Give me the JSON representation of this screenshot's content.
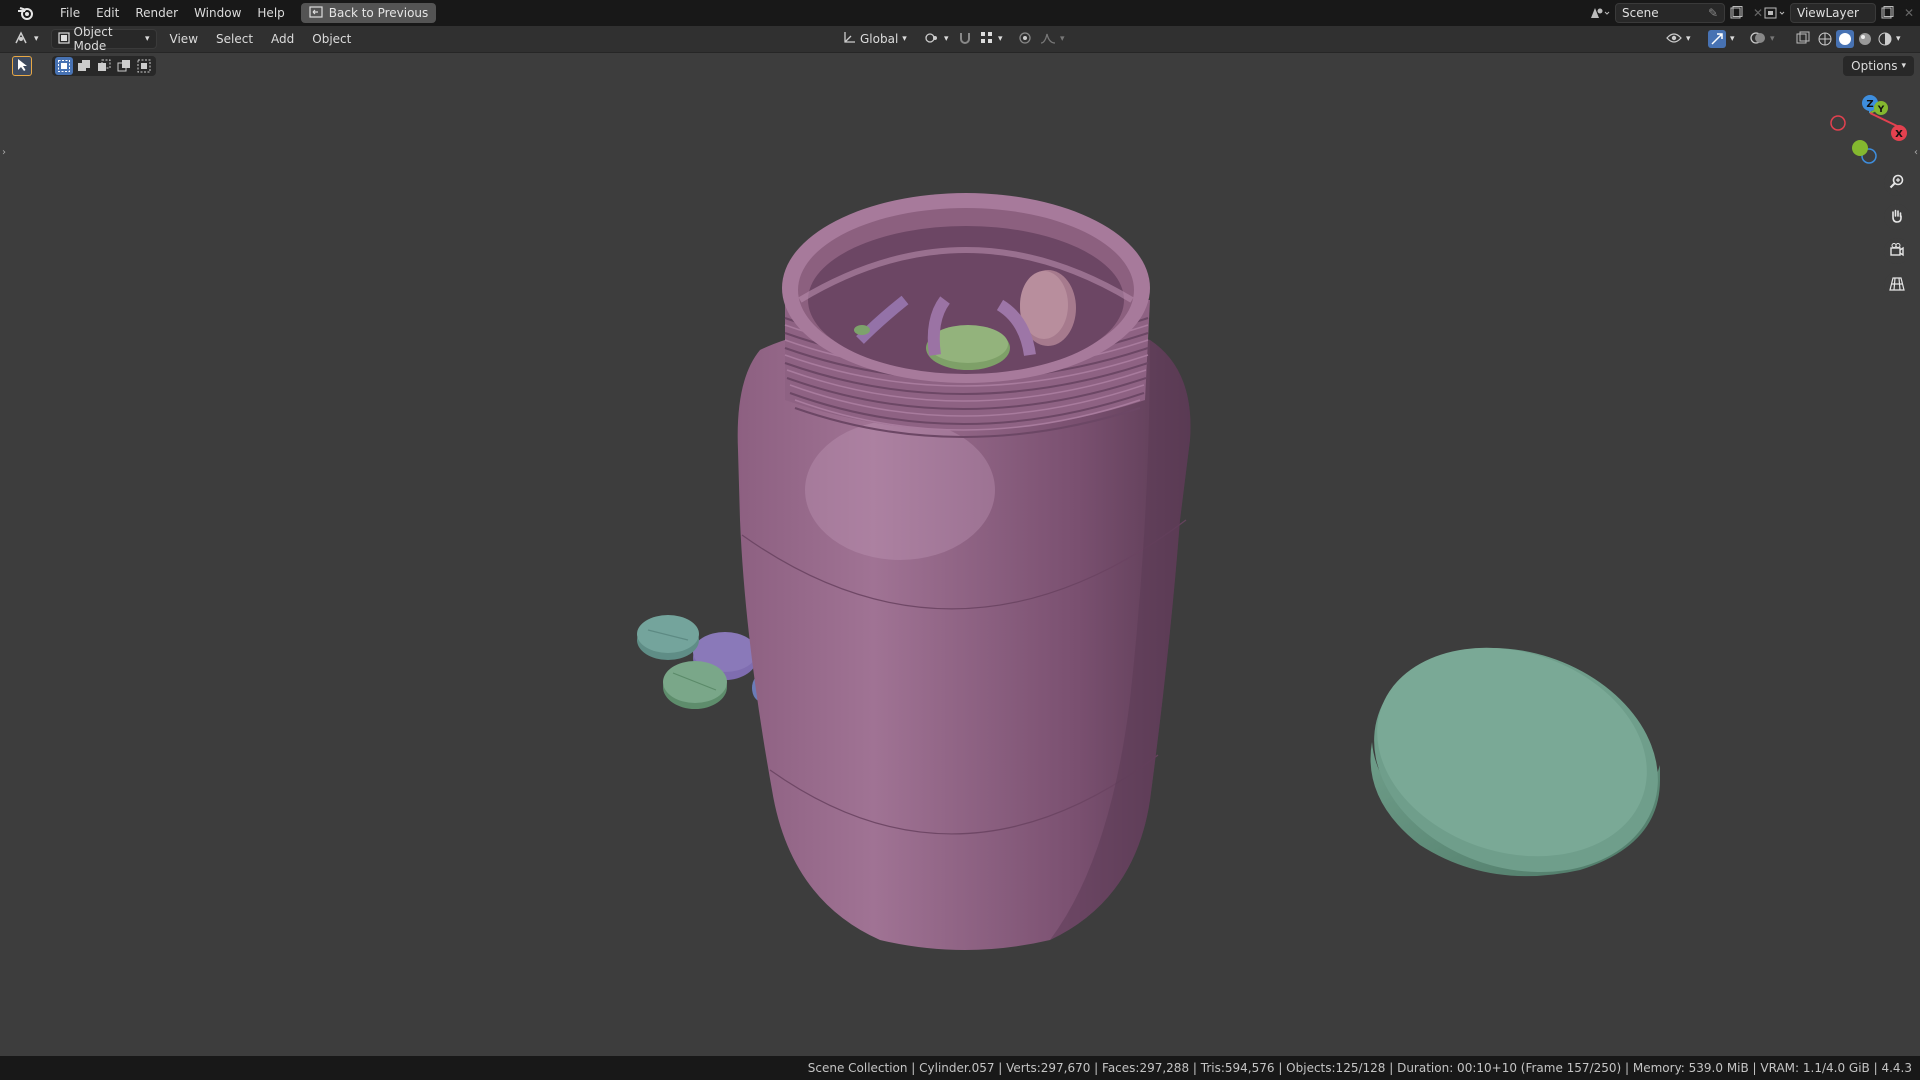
{
  "topbar": {
    "menus": [
      "File",
      "Edit",
      "Render",
      "Window",
      "Help"
    ],
    "back_button": "Back to Previous",
    "scene_name": "Scene",
    "view_layer_name": "ViewLayer"
  },
  "header": {
    "mode": "Object Mode",
    "menus": [
      "View",
      "Select",
      "Add",
      "Object"
    ],
    "transform_orientation": "Global"
  },
  "viewport": {
    "options_label": "Options",
    "gizmo": {
      "z": "Z",
      "y": "Y",
      "x": "X"
    },
    "colors": {
      "background": "#3d3d3d",
      "jar": "#9a6b8f",
      "lid": "#6e9d8b",
      "pill_teal": "#6e9d96",
      "pill_purple": "#7a6aa0",
      "pill_green": "#78a286",
      "axis_x": "#e3414f",
      "axis_y": "#84b82f",
      "axis_z": "#3e8ede"
    },
    "icons": [
      "search-icon",
      "hand-pan-icon",
      "camera-icon",
      "grid-icon"
    ]
  },
  "statusbar": {
    "text": "Scene Collection | Cylinder.057 | Verts:297,670 | Faces:297,288 | Tris:594,576 | Objects:125/128 | Duration: 00:10+10 (Frame 157/250) | Memory: 539.0 MiB | VRAM: 1.1/4.0 GiB | 4.4.3"
  }
}
